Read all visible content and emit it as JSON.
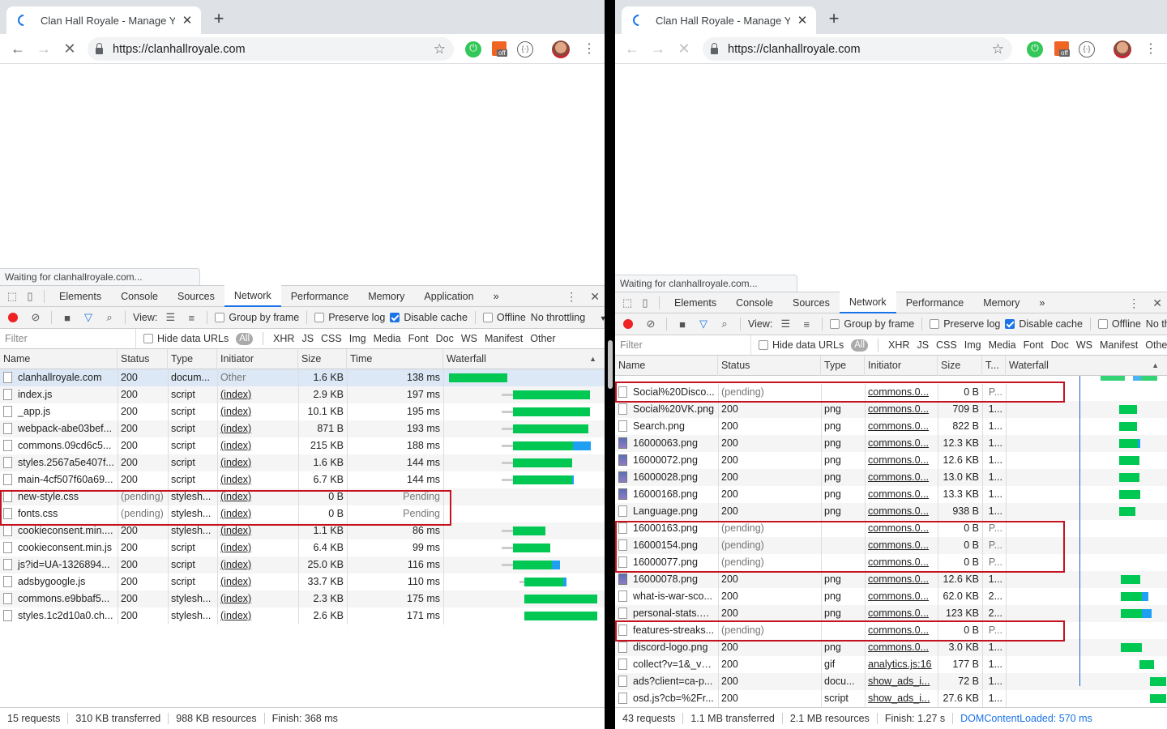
{
  "left": {
    "tab_title": "Clan Hall Royale - Manage Your",
    "url": "https://clanhallroyale.com",
    "status_bubble": "Waiting for clanhallroyale.com...",
    "devtools_tabs": [
      "Elements",
      "Console",
      "Sources",
      "Network",
      "Performance",
      "Memory",
      "Application"
    ],
    "active_tab": "Network",
    "filterbar": {
      "view_label": "View:",
      "group_by_frame": "Group by frame",
      "preserve_log": "Preserve log",
      "disable_cache": "Disable cache",
      "offline": "Offline",
      "throttling": "No throttling"
    },
    "typebar": {
      "filter_placeholder": "Filter",
      "hide_data_urls": "Hide data URLs",
      "types": [
        "All",
        "XHR",
        "JS",
        "CSS",
        "Img",
        "Media",
        "Font",
        "Doc",
        "WS",
        "Manifest",
        "Other"
      ]
    },
    "columns": [
      "Name",
      "Status",
      "Type",
      "Initiator",
      "Size",
      "Time",
      "Waterfall"
    ],
    "rows": [
      {
        "name": "clanhallroyale.com",
        "status": "200",
        "type": "docum...",
        "initiator": "Other",
        "size": "1.6 KB",
        "time": "138 ms",
        "wf_wait": 0,
        "wf_bar": 72,
        "wf_dl": 0,
        "wf_start": 7
      },
      {
        "name": "index.js",
        "status": "200",
        "type": "script",
        "initiator": "(index)",
        "size": "2.9 KB",
        "time": "197 ms",
        "wf_wait": 14,
        "wf_bar": 95,
        "wf_dl": 0,
        "wf_start": 86
      },
      {
        "name": "_app.js",
        "status": "200",
        "type": "script",
        "initiator": "(index)",
        "size": "10.1 KB",
        "time": "195 ms",
        "wf_wait": 14,
        "wf_bar": 95,
        "wf_dl": 0,
        "wf_start": 86
      },
      {
        "name": "webpack-abe03bef...",
        "status": "200",
        "type": "script",
        "initiator": "(index)",
        "size": "871 B",
        "time": "193 ms",
        "wf_wait": 14,
        "wf_bar": 93,
        "wf_dl": 0,
        "wf_start": 86
      },
      {
        "name": "commons.09cd6c5...",
        "status": "200",
        "type": "script",
        "initiator": "(index)",
        "size": "215 KB",
        "time": "188 ms",
        "wf_wait": 14,
        "wf_bar": 74,
        "wf_dl": 22,
        "wf_start": 86
      },
      {
        "name": "styles.2567a5e407f...",
        "status": "200",
        "type": "script",
        "initiator": "(index)",
        "size": "1.6 KB",
        "time": "144 ms",
        "wf_wait": 14,
        "wf_bar": 73,
        "wf_dl": 0,
        "wf_start": 86
      },
      {
        "name": "main-4cf507f60a69...",
        "status": "200",
        "type": "script",
        "initiator": "(index)",
        "size": "6.7 KB",
        "time": "144 ms",
        "wf_wait": 14,
        "wf_bar": 73,
        "wf_dl": 2,
        "wf_start": 86
      },
      {
        "name": "new-style.css",
        "status": "(pending)",
        "type": "stylesh...",
        "initiator": "(index)",
        "size": "0 B",
        "time": "Pending",
        "pending": true
      },
      {
        "name": "fonts.css",
        "status": "(pending)",
        "type": "stylesh...",
        "initiator": "(index)",
        "size": "0 B",
        "time": "Pending",
        "pending": true
      },
      {
        "name": "cookieconsent.min....",
        "status": "200",
        "type": "stylesh...",
        "initiator": "(index)",
        "size": "1.1 KB",
        "time": "86 ms",
        "wf_wait": 14,
        "wf_bar": 40,
        "wf_dl": 0,
        "wf_start": 86
      },
      {
        "name": "cookieconsent.min.js",
        "status": "200",
        "type": "script",
        "initiator": "(index)",
        "size": "6.4 KB",
        "time": "99 ms",
        "wf_wait": 14,
        "wf_bar": 46,
        "wf_dl": 0,
        "wf_start": 86
      },
      {
        "name": "js?id=UA-1326894...",
        "status": "200",
        "type": "script",
        "initiator": "(index)",
        "size": "25.0 KB",
        "time": "116 ms",
        "wf_wait": 14,
        "wf_bar": 48,
        "wf_dl": 10,
        "wf_start": 86
      },
      {
        "name": "adsbygoogle.js",
        "status": "200",
        "type": "script",
        "initiator": "(index)",
        "size": "33.7 KB",
        "time": "110 ms",
        "wf_wait": 6,
        "wf_bar": 48,
        "wf_dl": 4,
        "wf_start": 100
      },
      {
        "name": "commons.e9bbaf5...",
        "status": "200",
        "type": "stylesh...",
        "initiator": "(index)",
        "size": "2.3 KB",
        "time": "175 ms",
        "wf_wait": 0,
        "wf_bar": 90,
        "wf_dl": 0,
        "wf_start": 100
      },
      {
        "name": "styles.1c2d10a0.ch...",
        "status": "200",
        "type": "stylesh...",
        "initiator": "(index)",
        "size": "2.6 KB",
        "time": "171 ms",
        "wf_wait": 0,
        "wf_bar": 90,
        "wf_dl": 0,
        "wf_start": 100
      }
    ],
    "summary": [
      "15 requests",
      "310 KB transferred",
      "988 KB resources",
      "Finish: 368 ms"
    ]
  },
  "right": {
    "tab_title": "Clan Hall Royale - Manage Your",
    "url": "https://clanhallroyale.com",
    "status_bubble": "Waiting for clanhallroyale.com...",
    "devtools_tabs": [
      "Elements",
      "Console",
      "Sources",
      "Network",
      "Performance",
      "Memory"
    ],
    "active_tab": "Network",
    "filterbar": {
      "view_label": "View:",
      "group_by_frame": "Group by frame",
      "preserve_log": "Preserve log",
      "disable_cache": "Disable cache",
      "offline": "Offline",
      "throttling": "No th"
    },
    "typebar": {
      "filter_placeholder": "Filter",
      "hide_data_urls": "Hide data URLs",
      "types": [
        "All",
        "XHR",
        "JS",
        "CSS",
        "Img",
        "Media",
        "Font",
        "Doc",
        "WS",
        "Manifest",
        "Other"
      ]
    },
    "columns": [
      "Name",
      "Status",
      "Type",
      "Initiator",
      "Size",
      "T...",
      "Waterfall"
    ],
    "rows": [
      {
        "name": "Social%20Disco...",
        "status": "(pending)",
        "type": "",
        "initiator": "commons.0...",
        "size": "0 B",
        "time": "P...",
        "pending": true
      },
      {
        "name": "Social%20VK.png",
        "status": "200",
        "type": "png",
        "initiator": "commons.0...",
        "size": "709 B",
        "time": "1...",
        "wf_bar": 22,
        "wf_dl": 0,
        "wf_start": 140
      },
      {
        "name": "Search.png",
        "status": "200",
        "type": "png",
        "initiator": "commons.0...",
        "size": "822 B",
        "time": "1...",
        "wf_bar": 22,
        "wf_dl": 0,
        "wf_start": 140
      },
      {
        "name": "16000063.png",
        "status": "200",
        "type": "png",
        "initiator": "commons.0...",
        "size": "12.3 KB",
        "time": "1...",
        "wf_bar": 23,
        "wf_dl": 3,
        "wf_start": 140,
        "icon": "img"
      },
      {
        "name": "16000072.png",
        "status": "200",
        "type": "png",
        "initiator": "commons.0...",
        "size": "12.6 KB",
        "time": "1...",
        "wf_bar": 25,
        "wf_dl": 0,
        "wf_start": 140,
        "icon": "img"
      },
      {
        "name": "16000028.png",
        "status": "200",
        "type": "png",
        "initiator": "commons.0...",
        "size": "13.0 KB",
        "time": "1...",
        "wf_bar": 25,
        "wf_dl": 0,
        "wf_start": 140,
        "icon": "img"
      },
      {
        "name": "16000168.png",
        "status": "200",
        "type": "png",
        "initiator": "commons.0...",
        "size": "13.3 KB",
        "time": "1...",
        "wf_bar": 26,
        "wf_dl": 0,
        "wf_start": 140,
        "icon": "img"
      },
      {
        "name": "Language.png",
        "status": "200",
        "type": "png",
        "initiator": "commons.0...",
        "size": "938 B",
        "time": "1...",
        "wf_bar": 20,
        "wf_dl": 0,
        "wf_start": 140
      },
      {
        "name": "16000163.png",
        "status": "(pending)",
        "type": "",
        "initiator": "commons.0...",
        "size": "0 B",
        "time": "P...",
        "pending": true
      },
      {
        "name": "16000154.png",
        "status": "(pending)",
        "type": "",
        "initiator": "commons.0...",
        "size": "0 B",
        "time": "P...",
        "pending": true
      },
      {
        "name": "16000077.png",
        "status": "(pending)",
        "type": "",
        "initiator": "commons.0...",
        "size": "0 B",
        "time": "P...",
        "pending": true
      },
      {
        "name": "16000078.png",
        "status": "200",
        "type": "png",
        "initiator": "commons.0...",
        "size": "12.6 KB",
        "time": "1...",
        "wf_bar": 24,
        "wf_dl": 0,
        "wf_start": 142,
        "icon": "img"
      },
      {
        "name": "what-is-war-sco...",
        "status": "200",
        "type": "png",
        "initiator": "commons.0...",
        "size": "62.0 KB",
        "time": "2...",
        "wf_bar": 26,
        "wf_dl": 8,
        "wf_start": 142
      },
      {
        "name": "personal-stats.png",
        "status": "200",
        "type": "png",
        "initiator": "commons.0...",
        "size": "123 KB",
        "time": "2...",
        "wf_bar": 26,
        "wf_dl": 12,
        "wf_start": 142
      },
      {
        "name": "features-streaks...",
        "status": "(pending)",
        "type": "",
        "initiator": "commons.0...",
        "size": "0 B",
        "time": "P...",
        "pending": true
      },
      {
        "name": "discord-logo.png",
        "status": "200",
        "type": "png",
        "initiator": "commons.0...",
        "size": "3.0 KB",
        "time": "1...",
        "wf_bar": 26,
        "wf_dl": 0,
        "wf_start": 142
      },
      {
        "name": "collect?v=1&_v=...",
        "status": "200",
        "type": "gif",
        "initiator": "analytics.js:16",
        "size": "177 B",
        "time": "1...",
        "wf_bar": 18,
        "wf_dl": 0,
        "wf_start": 165
      },
      {
        "name": "ads?client=ca-p...",
        "status": "200",
        "type": "docu...",
        "initiator": "show_ads_i...",
        "size": "72 B",
        "time": "1...",
        "wf_bar": 20,
        "wf_dl": 0,
        "wf_start": 178
      },
      {
        "name": "osd.js?cb=%2Fr...",
        "status": "200",
        "type": "script",
        "initiator": "show_ads_i...",
        "size": "27.6 KB",
        "time": "1...",
        "wf_bar": 20,
        "wf_dl": 0,
        "wf_start": 178
      }
    ],
    "summary": [
      "43 requests",
      "1.1 MB transferred",
      "2.1 MB resources",
      "Finish: 1.27 s",
      "DOMContentLoaded: 570 ms"
    ]
  }
}
